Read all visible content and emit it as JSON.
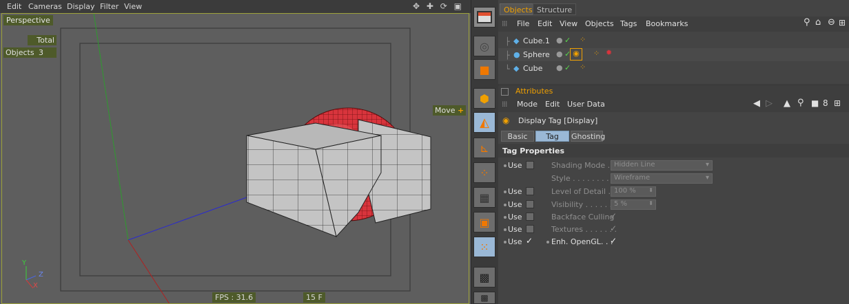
{
  "viewport": {
    "menu": [
      "Edit",
      "Cameras",
      "Display",
      "Filter",
      "View"
    ],
    "nav_icons": "✥ ✚ ⟳ ▣",
    "camera": "Perspective",
    "hud_total": "Total",
    "hud_objects_label": "Objects",
    "hud_objects_value": "3",
    "move_label": "Move",
    "fps": "FPS : 31.6",
    "frame": "15 F",
    "axis_y": "Y",
    "axis_z": "Z",
    "axis_x": "X"
  },
  "objects": {
    "tabs": [
      "Objects",
      "Structure"
    ],
    "menu": [
      "File",
      "Edit",
      "View",
      "Objects",
      "Tags",
      "Bookmarks"
    ],
    "items": [
      {
        "name": "Cube.1"
      },
      {
        "name": "Sphere"
      },
      {
        "name": "Cube"
      }
    ]
  },
  "attributes": {
    "title": "Attributes",
    "menu": [
      "Mode",
      "Edit",
      "User Data"
    ],
    "tag_title": "Display Tag [Display]",
    "tabs": [
      "Basic",
      "Tag",
      "Ghosting"
    ],
    "section": "Tag Properties",
    "use_label": "Use",
    "props": [
      {
        "name": "Shading Mode . .",
        "value": "Hidden Line"
      },
      {
        "name": "Style . . . . . . . . .",
        "value": "Wireframe"
      },
      {
        "name": "Level of Detail . .",
        "value": "100 %"
      },
      {
        "name": "Visibility . . . . . . . .",
        "value": "5 %"
      },
      {
        "name": "Backface Culling",
        "value": "✓"
      },
      {
        "name": "Textures . . . . . . .",
        "value": "✓"
      },
      {
        "name": "Enh. OpenGL. . .",
        "value": "✓"
      }
    ]
  },
  "colors": {
    "accent_orange": "#f0a000",
    "hud_green": "#4e5a2a",
    "tab_active": "#9ab8d6",
    "sphere_red": "#d8343c"
  }
}
